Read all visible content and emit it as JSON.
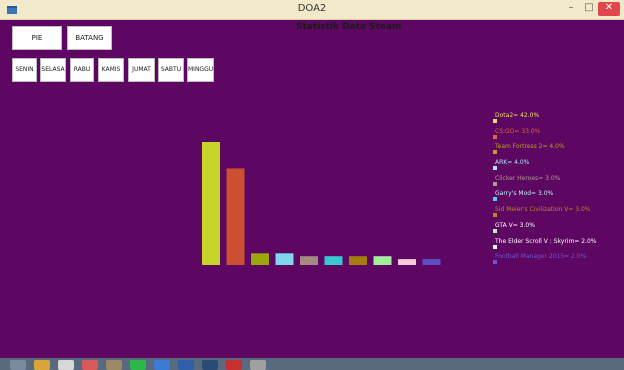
{
  "window": {
    "title": "DOA2",
    "minimize_glyph": "–",
    "maximize_glyph": "□",
    "close_glyph": "✕"
  },
  "toolbar": {
    "pie_label": "PIE",
    "batang_label": "BATANG"
  },
  "days": [
    "SENIN",
    "SELASA",
    "RABU",
    "KAMIS",
    "JUMAT",
    "SABTU",
    "MINGGU"
  ],
  "chart_data": {
    "type": "bar",
    "title": "Statistik Data Steam",
    "categories": [
      "Dota2",
      "CS:GO",
      "Team Fortress 2",
      "ARK",
      "Clicker Heroes",
      "Garry's Mod",
      "Sid Meier's Civilization V",
      "GTA V",
      "The Elder Scroll V : Skyrim",
      "Football Manager 2015"
    ],
    "values": [
      42.0,
      33.0,
      4.0,
      4.0,
      3.0,
      3.0,
      3.0,
      3.0,
      2.0,
      2.0
    ],
    "colors": [
      "#c5d52a",
      "#cd4f32",
      "#9aa80c",
      "#7fd6ee",
      "#a48a80",
      "#37c9d1",
      "#a67d10",
      "#a4ec9e",
      "#f0cad6",
      "#5c4fc1"
    ],
    "legend": [
      {
        "label": "Dota2= 42.0%",
        "text_color": "#e8e25a",
        "swatch": "#e8e25a"
      },
      {
        "label": "CS:GO= 33.0%",
        "text_color": "#d26a3c",
        "swatch": "#d26a3c"
      },
      {
        "label": "Team Fortress 2= 4.0%",
        "text_color": "#b8a420",
        "swatch": "#b8a420"
      },
      {
        "label": "ARK= 4.0%",
        "text_color": "#a9e9f8",
        "swatch": "#a9e9f8"
      },
      {
        "label": "Clicker Heroes= 3.0%",
        "text_color": "#b39a8f",
        "swatch": "#b39a8f"
      },
      {
        "label": "Garry's Mod= 3.0%",
        "text_color": "#b9f2f8",
        "swatch": "#4cd5ea"
      },
      {
        "label": "Sid Meier's Civilization V= 3.0%",
        "text_color": "#b5891a",
        "swatch": "#b5891a"
      },
      {
        "label": "GTA V= 3.0%",
        "text_color": "#ffffff",
        "swatch": "#b9f3b0"
      },
      {
        "label": "The Elder Scroll V : Skyrim= 2.0%",
        "text_color": "#ffffff",
        "swatch": "#ffffff"
      },
      {
        "label": "Football Manager 2015= 2.0%",
        "text_color": "#6a56d4",
        "swatch": "#6a56d4"
      }
    ]
  },
  "taskbar": {
    "icons": [
      {
        "name": "start-icon",
        "color": "#7c8aa0"
      },
      {
        "name": "chrome-icon",
        "color": "#d9a53a"
      },
      {
        "name": "file-icon",
        "color": "#d8d8d8"
      },
      {
        "name": "media-icon",
        "color": "#d85a5a"
      },
      {
        "name": "folder-icon",
        "color": "#9c8a66"
      },
      {
        "name": "chat-icon",
        "color": "#2fb84a"
      },
      {
        "name": "browser-icon",
        "color": "#3a7bd5"
      },
      {
        "name": "word-icon",
        "color": "#2f5fa8"
      },
      {
        "name": "app-icon",
        "color": "#2a4a78"
      },
      {
        "name": "pdf-icon",
        "color": "#c83030"
      },
      {
        "name": "java-icon",
        "color": "#a0a0a0"
      }
    ]
  }
}
